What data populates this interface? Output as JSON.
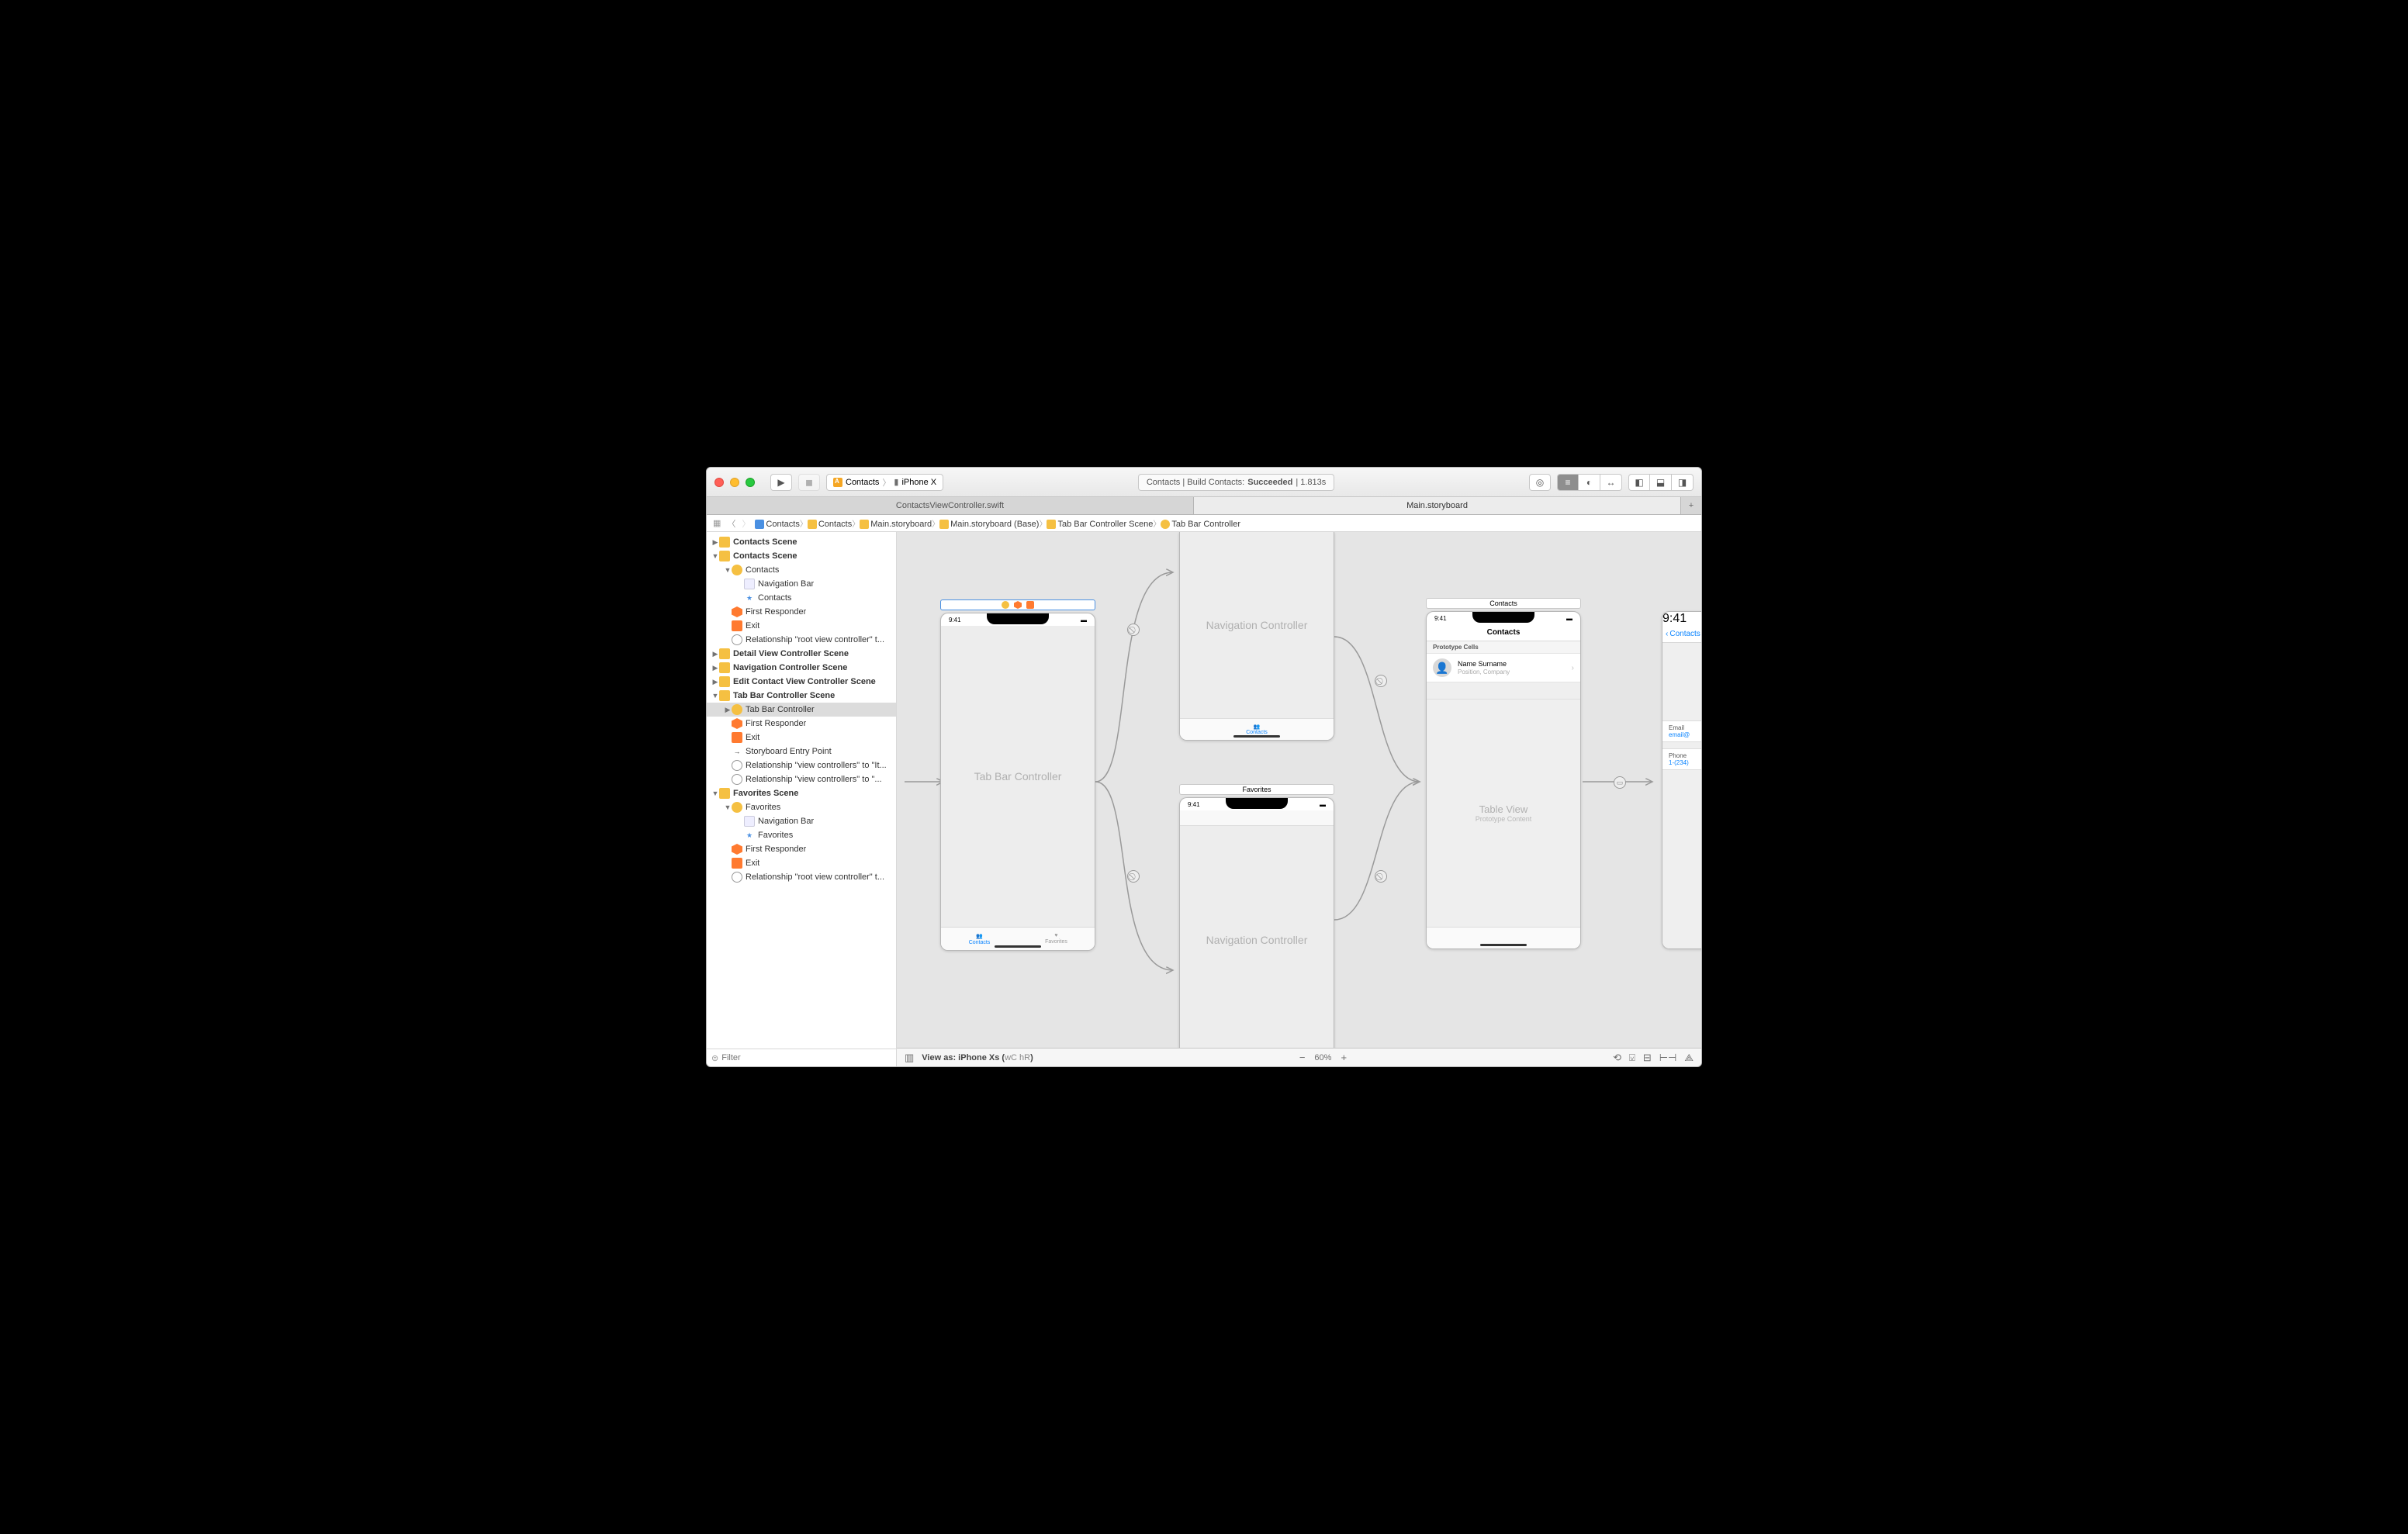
{
  "toolbar": {
    "scheme_app": "Contacts",
    "scheme_device": "iPhone X",
    "status_prefix": "Contacts | Build Contacts: ",
    "status_result": "Succeeded",
    "status_time": " | 1.813s"
  },
  "tabs": {
    "left": "ContactsViewController.swift",
    "right": "Main.storyboard"
  },
  "breadcrumb": [
    {
      "icon": "proj",
      "label": "Contacts"
    },
    {
      "icon": "fold",
      "label": "Contacts"
    },
    {
      "icon": "sb",
      "label": "Main.storyboard"
    },
    {
      "icon": "sb",
      "label": "Main.storyboard (Base)"
    },
    {
      "icon": "scene",
      "label": "Tab Bar Controller Scene"
    },
    {
      "icon": "vc",
      "label": "Tab Bar Controller"
    }
  ],
  "outline": [
    {
      "d": 0,
      "t": "▶",
      "i": "scene-o",
      "l": "Contacts Scene",
      "b": 1
    },
    {
      "d": 0,
      "t": "▼",
      "i": "scene-o",
      "l": "Contacts Scene",
      "b": 1
    },
    {
      "d": 1,
      "t": "▼",
      "i": "y",
      "l": "Contacts"
    },
    {
      "d": 2,
      "t": "",
      "i": "bar",
      "l": "Navigation Bar"
    },
    {
      "d": 2,
      "t": "",
      "i": "star",
      "l": "Contacts"
    },
    {
      "d": 1,
      "t": "",
      "i": "cube",
      "l": "First Responder"
    },
    {
      "d": 1,
      "t": "",
      "i": "exit",
      "l": "Exit"
    },
    {
      "d": 1,
      "t": "",
      "i": "circ",
      "l": "Relationship \"root view controller\" t..."
    },
    {
      "d": 0,
      "t": "▶",
      "i": "scene-o",
      "l": "Detail View Controller Scene",
      "b": 1
    },
    {
      "d": 0,
      "t": "▶",
      "i": "scene-o",
      "l": "Navigation Controller Scene",
      "b": 1
    },
    {
      "d": 0,
      "t": "▶",
      "i": "scene-o",
      "l": "Edit Contact View Controller Scene",
      "b": 1
    },
    {
      "d": 0,
      "t": "▼",
      "i": "scene-o",
      "l": "Tab Bar Controller Scene",
      "b": 1
    },
    {
      "d": 1,
      "t": "▶",
      "i": "y",
      "l": "Tab Bar Controller",
      "sel": 1
    },
    {
      "d": 1,
      "t": "",
      "i": "cube",
      "l": "First Responder"
    },
    {
      "d": 1,
      "t": "",
      "i": "exit",
      "l": "Exit"
    },
    {
      "d": 1,
      "t": "",
      "i": "arrow",
      "l": "Storyboard Entry Point"
    },
    {
      "d": 1,
      "t": "",
      "i": "circ",
      "l": "Relationship \"view controllers\" to \"It..."
    },
    {
      "d": 1,
      "t": "",
      "i": "circ",
      "l": "Relationship \"view controllers\" to \"..."
    },
    {
      "d": 0,
      "t": "▼",
      "i": "scene-o",
      "l": "Favorites Scene",
      "b": 1
    },
    {
      "d": 1,
      "t": "▼",
      "i": "y",
      "l": "Favorites"
    },
    {
      "d": 2,
      "t": "",
      "i": "bar",
      "l": "Navigation Bar"
    },
    {
      "d": 2,
      "t": "",
      "i": "star",
      "l": "Favorites"
    },
    {
      "d": 1,
      "t": "",
      "i": "cube",
      "l": "First Responder"
    },
    {
      "d": 1,
      "t": "",
      "i": "exit",
      "l": "Exit"
    },
    {
      "d": 1,
      "t": "",
      "i": "circ",
      "l": "Relationship \"root view controller\" t..."
    }
  ],
  "filter_placeholder": "Filter",
  "canvas": {
    "tabbar_title": "Tab Bar Controller",
    "tabbar_tab1": "Contacts",
    "tabbar_tab2": "Favorites",
    "nav1_title": "Navigation Controller",
    "nav1_tab": "Contacts",
    "nav2_title": "Navigation Controller",
    "fav_bar": "Favorites",
    "contacts_navtitle": "Contacts",
    "contacts_section": "Prototype Cells",
    "cell_name": "Name Surname",
    "cell_sub": "Position, Company",
    "tv_placeholder": "Table View",
    "tv_sub": "Prototype Content",
    "detail_back": "Contacts",
    "detail_email_lbl": "Email",
    "detail_email_val": "email@",
    "detail_phone_lbl": "Phone",
    "detail_phone_val": "1-(234)",
    "time": "9:41"
  },
  "bottombar": {
    "viewas": "View as: iPhone Xs (",
    "viewas_traits": "wC hR",
    "viewas_close": ")",
    "zoom": "60%"
  }
}
